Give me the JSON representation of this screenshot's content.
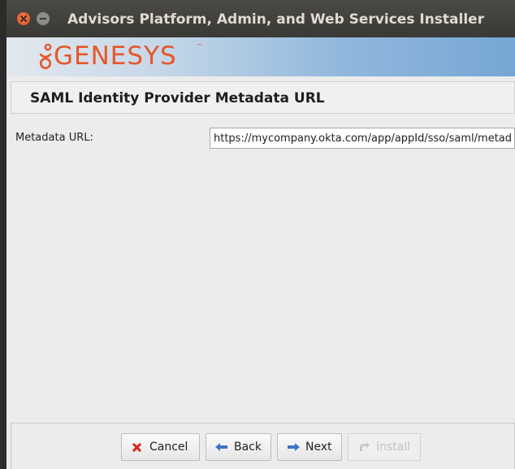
{
  "window": {
    "title": "Advisors Platform, Admin, and Web Services Installer"
  },
  "banner": {
    "logo_text": "GENESYS",
    "logo_tm": "™"
  },
  "section": {
    "title": "SAML Identity Provider Metadata URL"
  },
  "form": {
    "metadata_label": "Metadata URL:",
    "metadata_value": "https://mycompany.okta.com/app/appId/sso/saml/metadata"
  },
  "footer": {
    "cancel_label": "Cancel",
    "back_label": "Back",
    "next_label": "Next",
    "install_label": "Install",
    "install_enabled": false
  },
  "icons": {
    "close": "close-icon",
    "minimize": "minimize-icon",
    "cancel": "x-icon",
    "back": "arrow-left-icon",
    "next": "arrow-right-icon",
    "install": "install-icon"
  },
  "colors": {
    "brand": "#e8562a",
    "titlebar": "#3c3b37",
    "banner_end": "#76a6d4",
    "cancel_icon": "#d9251b",
    "arrow_icon": "#3d74c6"
  }
}
